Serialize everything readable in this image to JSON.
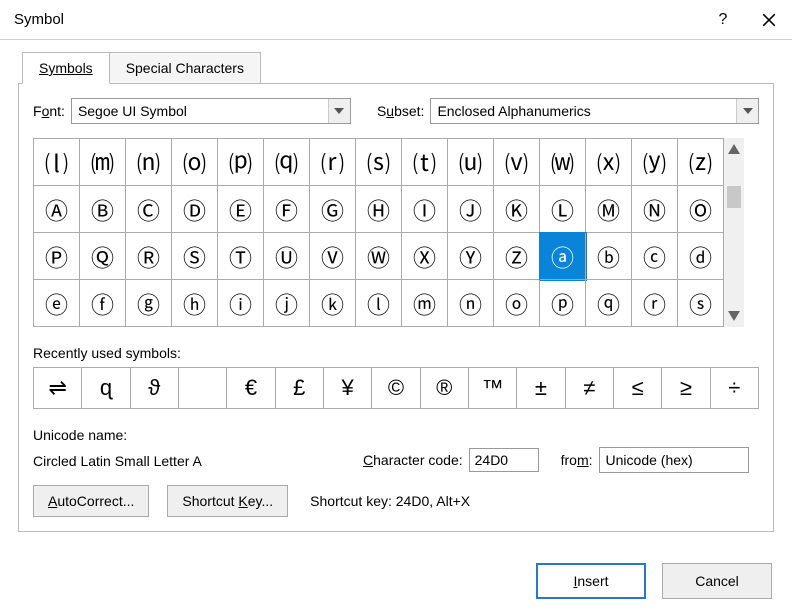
{
  "title": "Symbol",
  "tabs": {
    "symbols": "Symbols",
    "special": "Special Characters"
  },
  "font": {
    "label_pre": "F",
    "label_ul": "o",
    "label_post": "nt:",
    "value": "Segoe UI Symbol"
  },
  "subset": {
    "label_pre": "S",
    "label_ul": "u",
    "label_post": "bset:",
    "value": "Enclosed Alphanumerics"
  },
  "grid": {
    "rows": [
      [
        "⒧",
        "⒨",
        "⒩",
        "⒪",
        "⒫",
        "⒬",
        "⒭",
        "⒮",
        "⒯",
        "⒰",
        "⒱",
        "⒲",
        "⒳",
        "⒴",
        "⒵"
      ],
      [
        "Ⓐ",
        "Ⓑ",
        "Ⓒ",
        "Ⓓ",
        "Ⓔ",
        "Ⓕ",
        "Ⓖ",
        "Ⓗ",
        "Ⓘ",
        "Ⓙ",
        "Ⓚ",
        "Ⓛ",
        "Ⓜ",
        "Ⓝ",
        "Ⓞ"
      ],
      [
        "Ⓟ",
        "Ⓠ",
        "Ⓡ",
        "Ⓢ",
        "Ⓣ",
        "Ⓤ",
        "Ⓥ",
        "Ⓦ",
        "Ⓧ",
        "Ⓨ",
        "Ⓩ",
        "ⓐ",
        "ⓑ",
        "ⓒ",
        "ⓓ"
      ],
      [
        "ⓔ",
        "ⓕ",
        "ⓖ",
        "ⓗ",
        "ⓘ",
        "ⓙ",
        "ⓚ",
        "ⓛ",
        "ⓜ",
        "ⓝ",
        "ⓞ",
        "ⓟ",
        "ⓠ",
        "ⓡ",
        "ⓢ"
      ]
    ],
    "selected_row": 2,
    "selected_col": 11
  },
  "recent": {
    "label_ul": "R",
    "label_post": "ecently used symbols:",
    "items": [
      "⇌",
      "ɋ",
      "ϑ",
      "",
      "€",
      "£",
      "¥",
      "©",
      "®",
      "™",
      "±",
      "≠",
      "≤",
      "≥",
      "÷"
    ]
  },
  "unicode": {
    "label": "Unicode name:",
    "value": "Circled Latin Small Letter A"
  },
  "charcode": {
    "label_ul": "C",
    "label_post": "haracter code:",
    "value": "24D0"
  },
  "from": {
    "label_pre": "fro",
    "label_ul": "m",
    "label_post": ":",
    "value": "Unicode (hex)"
  },
  "buttons": {
    "autocorrect_ul": "A",
    "autocorrect_post": "utoCorrect...",
    "shortcutkey_pre": "Shortcut ",
    "shortcutkey_ul": "K",
    "shortcutkey_post": "ey...",
    "insert_ul": "I",
    "insert_post": "nsert",
    "cancel": "Cancel"
  },
  "shortcut_readout": "Shortcut key: 24D0, Alt+X"
}
